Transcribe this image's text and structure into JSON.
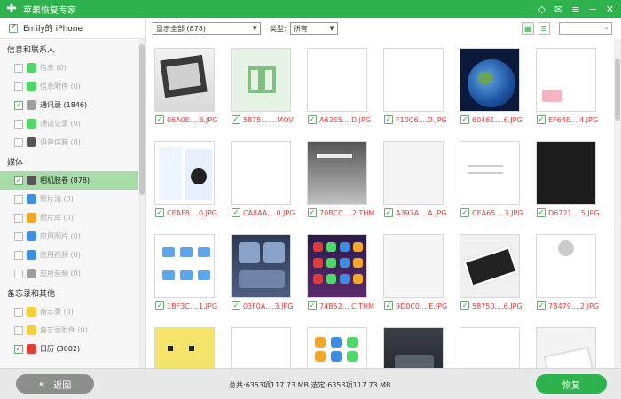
{
  "app": {
    "title": "苹果恢复专家"
  },
  "device": {
    "name": "Emily的 iPhone"
  },
  "sidebar": {
    "groups": [
      {
        "title": "信息和联系人",
        "items": [
          {
            "label": "信息 (0)",
            "checked": false,
            "active": false,
            "icon": "message-icon",
            "color": "#4cd964"
          },
          {
            "label": "信息附件 (0)",
            "checked": false,
            "active": false,
            "icon": "message-attachment-icon",
            "color": "#4cd964"
          },
          {
            "label": "通讯录 (1846)",
            "checked": true,
            "active": false,
            "icon": "contacts-icon",
            "color": "#9e9e9e"
          },
          {
            "label": "通话记录 (0)",
            "checked": false,
            "active": false,
            "icon": "phone-icon",
            "color": "#4cd964"
          },
          {
            "label": "语音信箱 (0)",
            "checked": false,
            "active": false,
            "icon": "voicemail-icon",
            "color": "#555555"
          }
        ]
      },
      {
        "title": "媒体",
        "items": [
          {
            "label": "相机胶卷 (878)",
            "checked": true,
            "active": true,
            "icon": "camera-icon",
            "color": "#555555"
          },
          {
            "label": "照片流 (0)",
            "checked": false,
            "active": false,
            "icon": "photo-stream-icon",
            "color": "#3a8ee6"
          },
          {
            "label": "照片库 (0)",
            "checked": false,
            "active": false,
            "icon": "photo-library-icon",
            "color": "#f5a623"
          },
          {
            "label": "应用图片 (0)",
            "checked": false,
            "active": false,
            "icon": "app-photos-icon",
            "color": "#3a8ee6"
          },
          {
            "label": "应用视频 (0)",
            "checked": false,
            "active": false,
            "icon": "app-videos-icon",
            "color": "#3a8ee6"
          },
          {
            "label": "应用音频 (0)",
            "checked": false,
            "active": false,
            "icon": "app-audio-icon",
            "color": "#9e9e9e"
          }
        ]
      },
      {
        "title": "备忘录和其他",
        "items": [
          {
            "label": "备忘录 (0)",
            "checked": false,
            "active": false,
            "icon": "notes-icon",
            "color": "#f5d033"
          },
          {
            "label": "备忘录附件 (0)",
            "checked": false,
            "active": false,
            "icon": "notes-attachment-icon",
            "color": "#f5d033"
          },
          {
            "label": "日历 (3002)",
            "checked": true,
            "active": false,
            "icon": "calendar-icon",
            "color": "#e53935"
          }
        ]
      }
    ]
  },
  "toolbar": {
    "filter": "显示全部 (878)",
    "type_label": "类型:",
    "type_value": "所有"
  },
  "grid": {
    "files": [
      {
        "name": "06A0E....B.JPG",
        "kind": "dark-room"
      },
      {
        "name": "5875.......MOV",
        "kind": "video"
      },
      {
        "name": "A62E5....D.JPG",
        "kind": "list"
      },
      {
        "name": "F10C6....D.JPG",
        "kind": "contacts"
      },
      {
        "name": "60461....6.JPG",
        "kind": "earth"
      },
      {
        "name": "EF64E....4.JPG",
        "kind": "calendar"
      },
      {
        "name": "CEAF8....0.JPG",
        "kind": "chat"
      },
      {
        "name": "CA8AA....0.JPG",
        "kind": "doc"
      },
      {
        "name": "70BCC....2.THM",
        "kind": "ceiling"
      },
      {
        "name": "A397A....A.JPG",
        "kind": "settings"
      },
      {
        "name": "CEA65....3.JPG",
        "kind": "minimal"
      },
      {
        "name": "D6721....5.JPG",
        "kind": "dark"
      },
      {
        "name": "1BF3C....1.JPG",
        "kind": "files"
      },
      {
        "name": "03F0A....3.JPG",
        "kind": "control"
      },
      {
        "name": "74B52....C.THM",
        "kind": "homescreen"
      },
      {
        "name": "9D0C0....E.JPG",
        "kind": "storage"
      },
      {
        "name": "58750....6.JPG",
        "kind": "phone-white"
      },
      {
        "name": "7B479....2.JPG",
        "kind": "account"
      },
      {
        "name": "",
        "kind": "yellow"
      },
      {
        "name": "",
        "kind": "blank"
      },
      {
        "name": "",
        "kind": "icons"
      },
      {
        "name": "",
        "kind": "dark-ui"
      },
      {
        "name": "",
        "kind": "list2"
      },
      {
        "name": "",
        "kind": "phone-white2"
      }
    ]
  },
  "footer": {
    "back_label": "返回",
    "status": "总共:6353项117.73 MB 选定:6353项117.73 MB",
    "recover_label": "恢复"
  },
  "colors": {
    "brand": "#2db24d",
    "error_text": "#e53935"
  }
}
